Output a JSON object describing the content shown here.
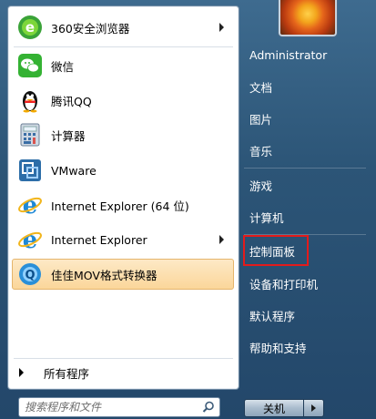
{
  "pinned_programs": [
    {
      "label": "360安全浏览器",
      "icon": "360-browser-icon",
      "has_submenu": true
    },
    {
      "label": "微信",
      "icon": "wechat-icon",
      "has_submenu": false
    },
    {
      "label": "腾讯QQ",
      "icon": "qq-penguin-icon",
      "has_submenu": false
    },
    {
      "label": "计算器",
      "icon": "calculator-icon",
      "has_submenu": false
    },
    {
      "label": "VMware",
      "icon": "vmware-icon",
      "has_submenu": false
    },
    {
      "label": "Internet Explorer (64 位)",
      "icon": "ie-icon",
      "has_submenu": false
    },
    {
      "label": "Internet Explorer",
      "icon": "ie-icon",
      "has_submenu": true
    },
    {
      "label": "佳佳MOV格式转换器",
      "icon": "mov-converter-icon",
      "has_submenu": false,
      "highlighted": true
    }
  ],
  "all_programs_label": "所有程序",
  "search": {
    "placeholder": "搜索程序和文件"
  },
  "user": {
    "name": "Administrator"
  },
  "right_links": [
    "文档",
    "图片",
    "音乐",
    "游戏",
    "计算机",
    "控制面板",
    "设备和打印机",
    "默认程序",
    "帮助和支持"
  ],
  "shutdown_label": "关机",
  "colors": {
    "highlight_border": "#e31b1b",
    "menu_bg": "#2c5577",
    "hover_bg": "#fbd69a"
  }
}
